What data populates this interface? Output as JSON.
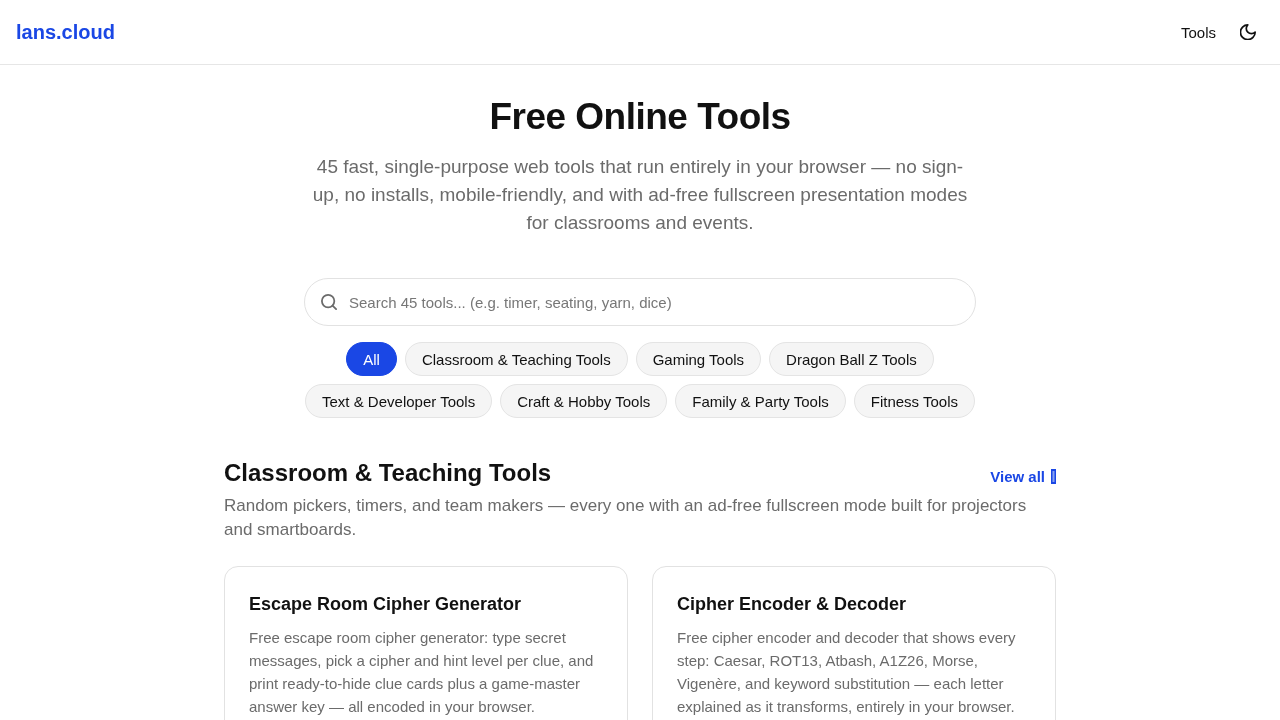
{
  "header": {
    "logo": "lans.cloud",
    "nav": [
      {
        "label": "Tools"
      }
    ]
  },
  "hero": {
    "title": "Free Online Tools",
    "subtitle": "45 fast, single-purpose web tools that run entirely in your browser — no sign-up, no installs, mobile-friendly, and with ad-free fullscreen presentation modes for classrooms and events."
  },
  "search": {
    "placeholder": "Search 45 tools... (e.g. timer, seating, yarn, dice)"
  },
  "filters": [
    {
      "label": "All",
      "selected": true
    },
    {
      "label": "Classroom & Teaching Tools",
      "selected": false
    },
    {
      "label": "Gaming Tools",
      "selected": false
    },
    {
      "label": "Dragon Ball Z Tools",
      "selected": false
    },
    {
      "label": "Text & Developer Tools",
      "selected": false
    },
    {
      "label": "Craft & Hobby Tools",
      "selected": false
    },
    {
      "label": "Family & Party Tools",
      "selected": false
    },
    {
      "label": "Fitness Tools",
      "selected": false
    }
  ],
  "section": {
    "title": "Classroom & Teaching Tools",
    "link": "View all",
    "description": "Random pickers, timers, and team makers — every one with an ad-free fullscreen mode built for projectors and smartboards."
  },
  "cards": [
    {
      "title": "Escape Room Cipher Generator",
      "description": "Free escape room cipher generator: type secret messages, pick a cipher and hint level per clue, and print ready-to-hide clue cards plus a game-master answer key — all encoded in your browser."
    },
    {
      "title": "Cipher Encoder & Decoder",
      "description": "Free cipher encoder and decoder that shows every step: Caesar, ROT13, Atbash, A1Z26, Morse, Vigenère, and keyword substitution — each letter explained as it transforms, entirely in your browser."
    }
  ]
}
